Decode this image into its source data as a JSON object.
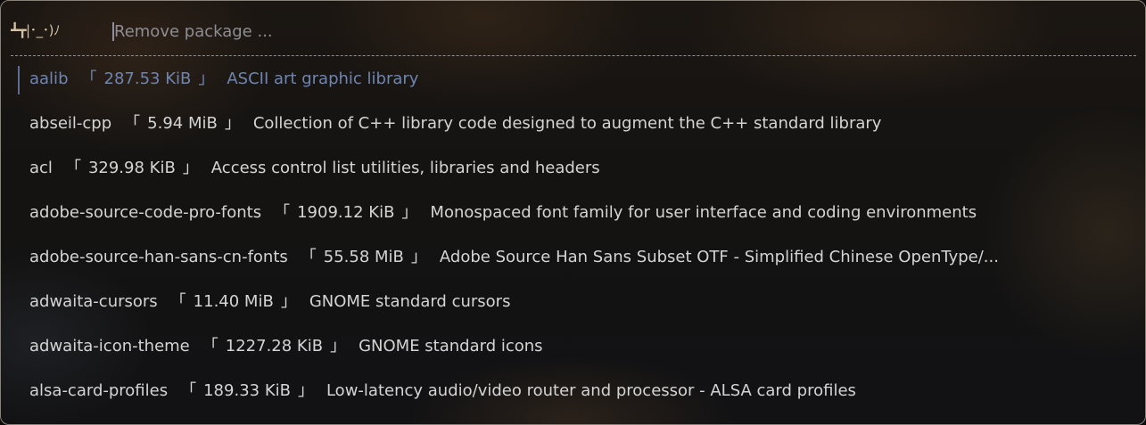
{
  "prompt": {
    "icon_text": "┻┳|･_･)ﾉ",
    "placeholder": "Remove package ..."
  },
  "brackets": {
    "open": "「",
    "close": "」"
  },
  "packages": [
    {
      "name": "aalib",
      "size": "287.53 KiB",
      "description": "ASCII art graphic library",
      "selected": true
    },
    {
      "name": "abseil-cpp",
      "size": "5.94 MiB",
      "description": "Collection of C++ library code designed to augment the C++ standard library"
    },
    {
      "name": "acl",
      "size": "329.98 KiB",
      "description": "Access control list utilities, libraries and headers"
    },
    {
      "name": "adobe-source-code-pro-fonts",
      "size": "1909.12 KiB",
      "description": "Monospaced font family for user interface and coding environments"
    },
    {
      "name": "adobe-source-han-sans-cn-fonts",
      "size": "55.58 MiB",
      "description": "Adobe Source Han Sans Subset OTF - Simplified Chinese OpenType/..."
    },
    {
      "name": "adwaita-cursors",
      "size": "11.40 MiB",
      "description": "GNOME standard cursors"
    },
    {
      "name": "adwaita-icon-theme",
      "size": "1227.28 KiB",
      "description": "GNOME standard icons"
    },
    {
      "name": "alsa-card-profiles",
      "size": "189.33 KiB",
      "description": "Low-latency audio/video router and processor - ALSA card profiles"
    }
  ],
  "colors": {
    "selected_text": "#6f85b0",
    "normal_text": "#d4d4d4",
    "accent_marker": "#5d6e92"
  }
}
